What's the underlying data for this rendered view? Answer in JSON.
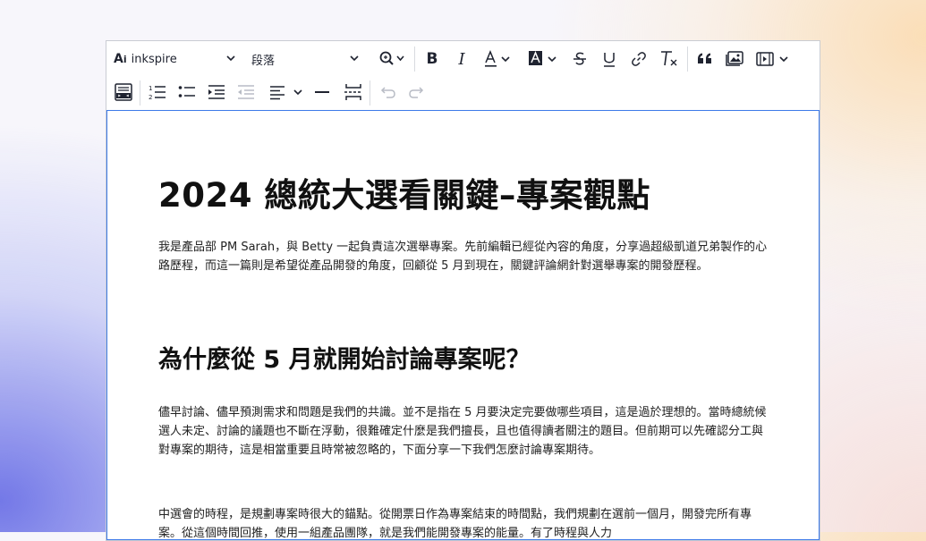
{
  "toolbar": {
    "font_family": "inkspire",
    "paragraph_style": "段落"
  },
  "document": {
    "heading1": "2024 總統大選看關鍵–專案觀點",
    "intro": "我是產品部 PM Sarah，與 Betty 一起負責這次選舉專案。先前編輯已經從內容的角度，分享過超級凱道兄弟製作的心路歷程，而這一篇則是希望從產品開發的角度，回顧從 5 月到現在，關鍵評論網針對選舉專案的開發歷程。",
    "heading2": "為什麼從 5 月就開始討論專案呢？",
    "para2": "儘早討論、儘早預測需求和問題是我們的共識。並不是指在 5 月要決定完要做哪些項目，這是過於理想的。當時總統候選人未定、討論的議題也不斷在浮動，很難確定什麼是我們擅長，且也值得讀者關注的題目。但前期可以先確認分工與對專案的期待，這是相當重要且時常被忽略的，下面分享一下我們怎麼討論專案期待。",
    "para3": "中選會的時程，是規劃專案時很大的錨點。從開票日作為專案結束的時間點，我們規劃在選前一個月，開發完所有專案。從這個時間回推，使用一組產品團隊，就是我們能開發專案的能量。有了時程與人力"
  }
}
